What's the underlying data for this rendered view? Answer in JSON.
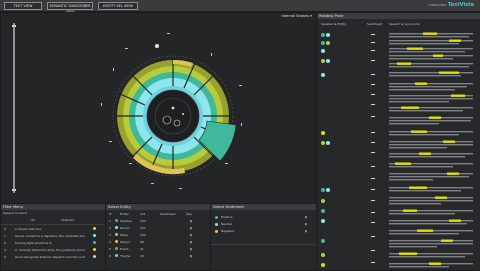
{
  "toolbar": {
    "btn1": "TEXT VIEW",
    "btn2": "SEMANTIC SUBSCRIBER VIEW",
    "btn3": "ENTITY SEL VIEW",
    "brand_prefix": "mooncake",
    "brand_name": "TextVista"
  },
  "main": {
    "dropdown": "Internal Strokes ▾"
  },
  "reading_pane": {
    "title": "Reading Pane",
    "col1": "Speaker & Entity",
    "col2": "Sentiment",
    "col3": "Speech & Surrounds"
  },
  "filter": {
    "title": "Filter Menu",
    "subtitle": "Speech Content",
    "tab1": "All",
    "tab2": "Selected",
    "rows": [
      {
        "id": "0",
        "text": "A simple test line"
      },
      {
        "id": "1",
        "text": "Group content is a dignitary: the complete email difficult"
      },
      {
        "id": "2",
        "text": "Kicking fight positions to"
      },
      {
        "id": "3",
        "text": "A. Chuckle attraction dirty: the positions dismiss accepts to"
      },
      {
        "id": "4",
        "text": "Good alongside diatonic dispatch and the content of work."
      }
    ]
  },
  "entities": {
    "title": "Select Entity",
    "cols": [
      "#",
      "Entity",
      "Cnt",
      "Sentiment",
      "Ops"
    ],
    "rows": [
      {
        "n": "1",
        "name": "Speaker",
        "cnt": "193"
      },
      {
        "n": "2",
        "name": "Person",
        "cnt": "191"
      },
      {
        "n": "3",
        "name": "Place",
        "cnt": "160"
      },
      {
        "n": "4",
        "name": "Object",
        "cnt": "88"
      },
      {
        "n": "5",
        "name": "Event",
        "cnt": "41"
      },
      {
        "n": "6",
        "name": "Theme",
        "cnt": "20"
      }
    ]
  },
  "sentiment": {
    "title": "Select Sentiment",
    "rows": [
      "Positive",
      "Neutral",
      "Negative"
    ]
  },
  "colors": {
    "teal": "#3fb89c",
    "cyan": "#8ee6ef",
    "lime": "#b7cc3a",
    "olive": "#9aa12a",
    "gold": "#e0c25a",
    "highlight": "#e1e000"
  }
}
